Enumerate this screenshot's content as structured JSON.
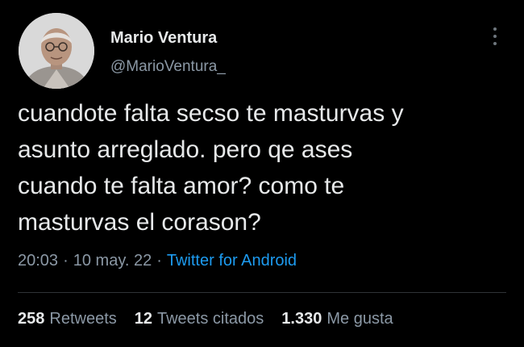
{
  "author": {
    "display_name": "Mario Ventura",
    "handle": "@MarioVentura_"
  },
  "tweet": {
    "lines": [
      "cuandote falta secso te masturvas y",
      "asunto arreglado. pero qe ases",
      "cuando te falta amor? como te",
      "masturvas el corason?"
    ]
  },
  "meta": {
    "time": "20:03",
    "date": "10 may. 22",
    "separator": "·",
    "source": "Twitter for Android"
  },
  "stats": {
    "retweets": {
      "count": "258",
      "label": "Retweets"
    },
    "quotes": {
      "count": "12",
      "label": "Tweets citados"
    },
    "likes": {
      "count": "1.330",
      "label": "Me gusta"
    }
  },
  "icons": {
    "more": "more-vertical-icon"
  },
  "colors": {
    "background": "#000000",
    "text": "#e7e9ea",
    "secondary": "#8b98a5",
    "link": "#1d9bf0"
  }
}
